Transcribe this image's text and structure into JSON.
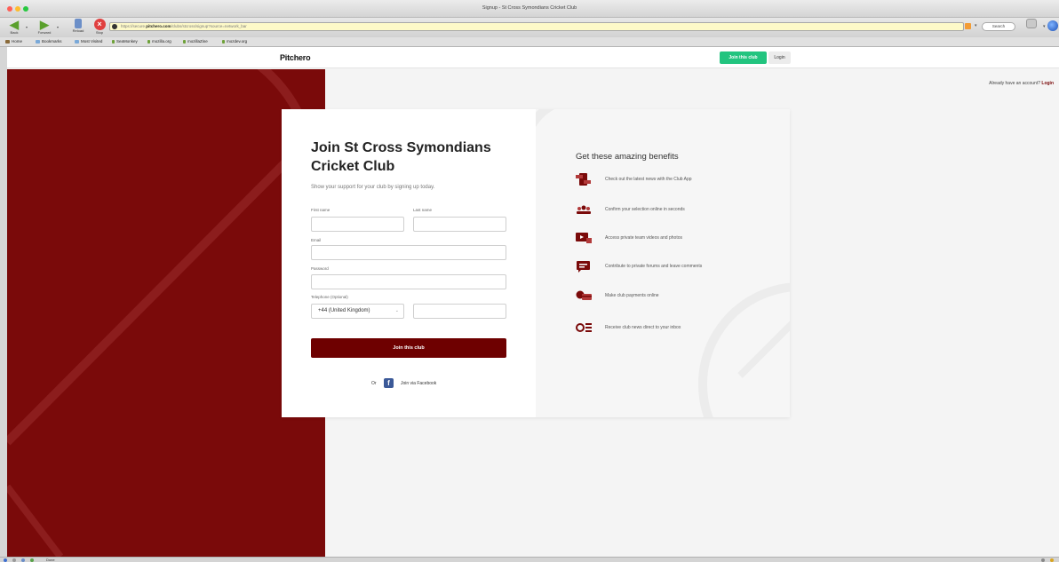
{
  "window": {
    "title": "Signup - St Cross Symondians Cricket Club"
  },
  "toolbar": {
    "back_label": "Back",
    "forward_label": "Forward",
    "reload_label": "Reload",
    "stop_label": "Stop",
    "url_prefix": "https://secure.",
    "url_domain": "pitchero.com",
    "url_path": "/clubs/stcross/signup?source=network_bar",
    "search_label": "Search",
    "print_label": "Print"
  },
  "bookmarks": [
    {
      "label": "Home",
      "icon": "home-icon"
    },
    {
      "label": "Bookmarks",
      "icon": "folder-icon"
    },
    {
      "label": "Most Visited",
      "icon": "folder-icon"
    },
    {
      "label": "SeaMonkey",
      "icon": "leaf-icon"
    },
    {
      "label": "mozilla.org",
      "icon": "leaf-icon"
    },
    {
      "label": "mozillaZine",
      "icon": "leaf-icon"
    },
    {
      "label": "mozdev.org",
      "icon": "leaf-icon"
    }
  ],
  "header": {
    "logo": "Pitchero",
    "join_button": "Join this club",
    "login_button": "Login"
  },
  "account": {
    "prompt": "Already have an account?",
    "login_link": "Login"
  },
  "form": {
    "title": "Join St Cross Symondians Cricket Club",
    "subtitle": "Show your support for your club by signing up today.",
    "first_name_label": "First name",
    "last_name_label": "Last name",
    "email_label": "Email",
    "password_label": "Password",
    "telephone_label": "Telephone (Optional)",
    "country_code": "+44 (United Kingdom)",
    "submit": "Join this club",
    "or": "Or",
    "facebook": "Join via Facebook"
  },
  "benefits": {
    "title": "Get these amazing benefits",
    "items": [
      {
        "text": "Check out the latest news with the Club App",
        "icon": "phone-news-icon"
      },
      {
        "text": "Confirm your selection online in seconds",
        "icon": "team-selection-icon"
      },
      {
        "text": "Access private team videos and photos",
        "icon": "video-icon"
      },
      {
        "text": "Contribute to private forums and leave comments",
        "icon": "comment-icon"
      },
      {
        "text": "Make club payments online",
        "icon": "payment-icon"
      },
      {
        "text": "Receive club news direct to your inbox",
        "icon": "newsletter-icon"
      }
    ]
  },
  "status": {
    "text": "Done"
  },
  "colors": {
    "brand_maroon": "#7a0a0a",
    "join_green": "#22c47f",
    "facebook_blue": "#3b5998"
  }
}
